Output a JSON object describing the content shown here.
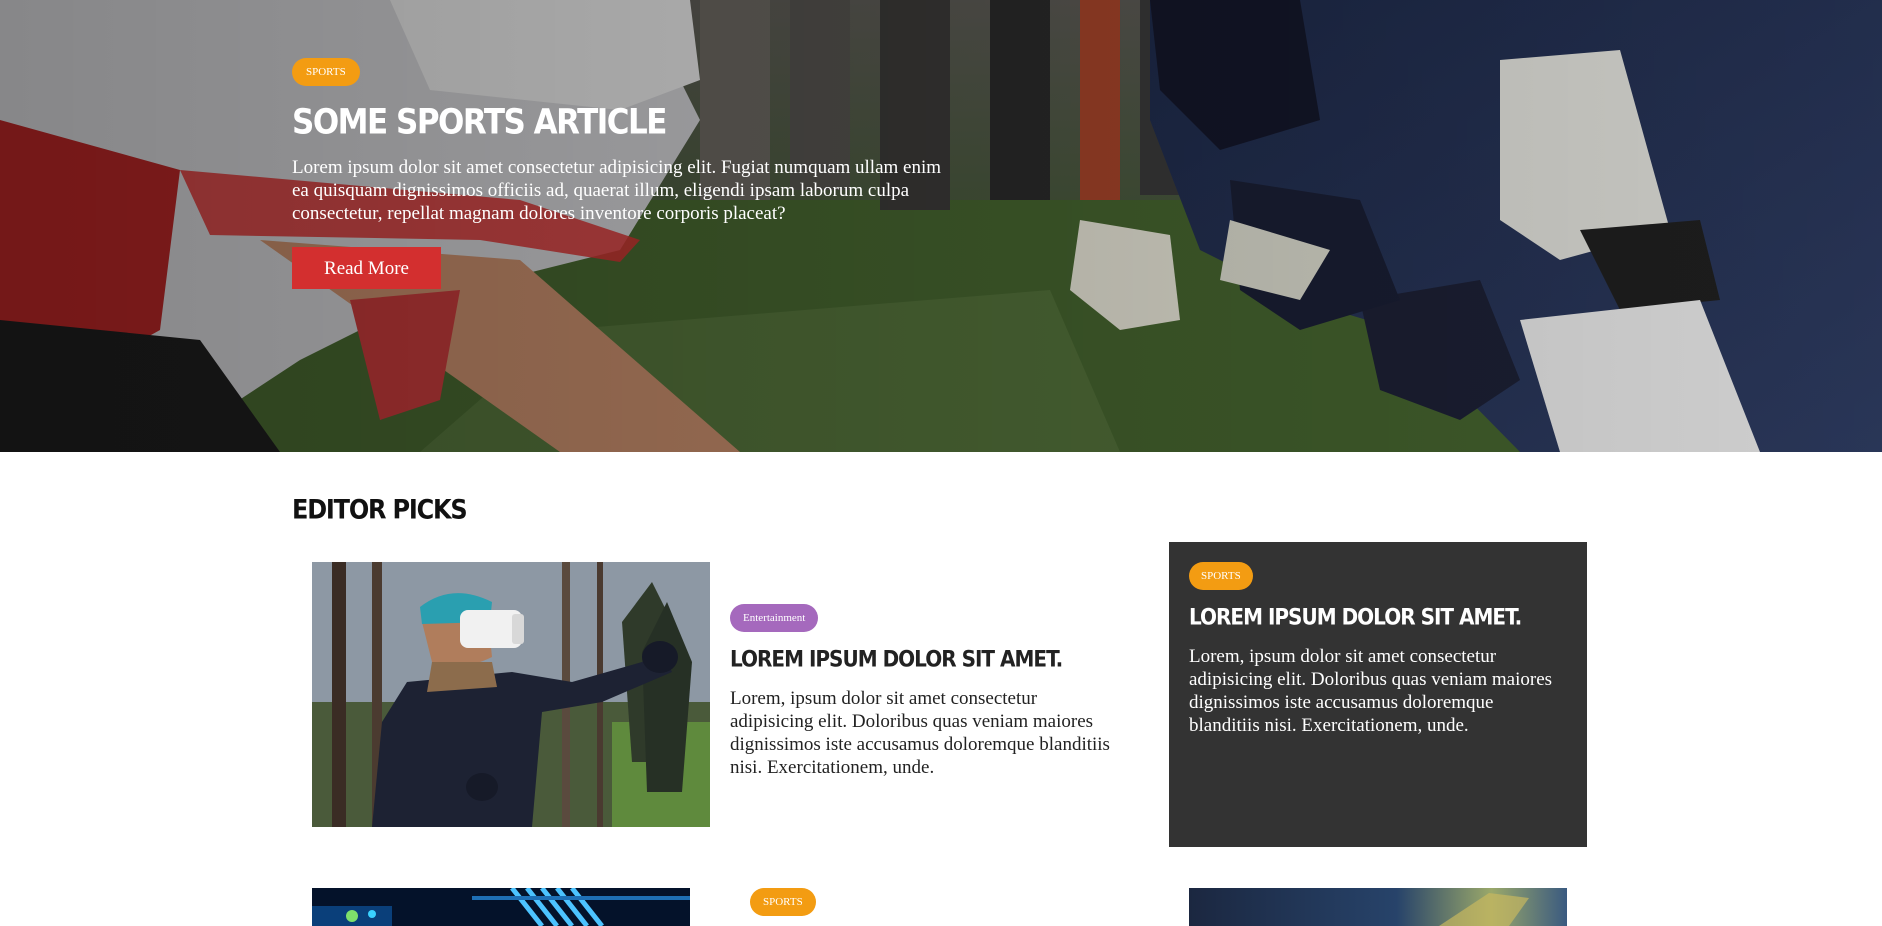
{
  "hero": {
    "category": "SPORTS",
    "title": "SOME SPORTS ARTICLE",
    "text": "Lorem ipsum dolor sit amet consectetur adipisicing elit. Fugiat numquam ullam enim ea quisquam dignissimos officiis ad, quaerat illum, eligendi ipsam laborum culpa consectetur, repellat magnam dolores inventore corporis placeat?",
    "button_label": "Read More"
  },
  "editor_picks": {
    "title": "EDITOR PICKS",
    "cards": [
      {
        "category": "Entertainment",
        "title": "LOREM IPSUM DOLOR SIT AMET.",
        "text": "Lorem, ipsum dolor sit amet consectetur adipisicing elit. Doloribus quas veniam maiores dignissimos iste accusamus doloremque blanditiis nisi. Exercitationem, unde."
      },
      {
        "category": "SPORTS",
        "title": "LOREM IPSUM DOLOR SIT AMET.",
        "text": "Lorem, ipsum dolor sit amet consectetur adipisicing elit. Doloribus quas veniam maiores dignissimos iste accusamus doloremque blanditiis nisi. Exercitationem, unde."
      }
    ],
    "row2_category": "SPORTS"
  },
  "colors": {
    "sports_badge": "#f39c12",
    "entertainment_badge": "#a569bd",
    "read_more_button": "#d32f2f",
    "dark_card": "#333333"
  },
  "images": {
    "hero": "football-linemen-photo",
    "card1": "vr-headset-man-forest-photo",
    "row2_left": "blue-network-cables-photo",
    "row2_right": "circuit-board-photo"
  }
}
